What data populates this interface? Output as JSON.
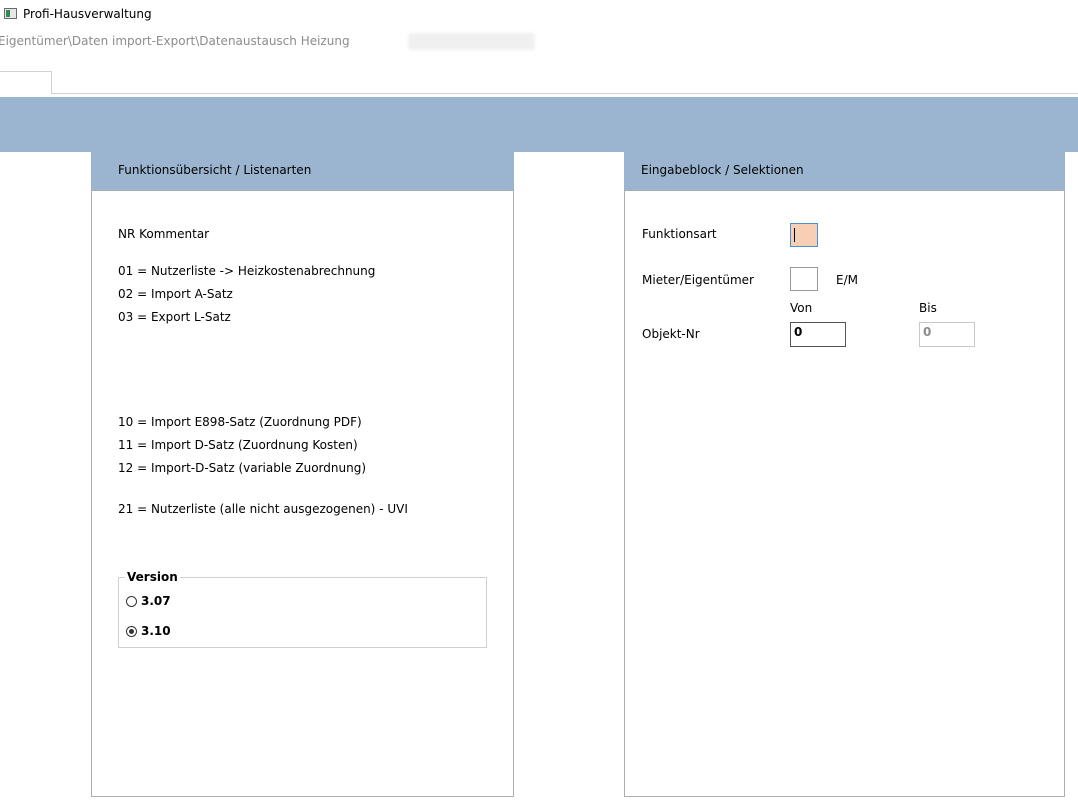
{
  "window": {
    "title": "Profi-Hausverwaltung",
    "breadcrumb": "Eigentümer\\Daten import-Export\\Datenaustausch Heizung"
  },
  "left_panel": {
    "header": "Funktionsübersicht / Listenarten",
    "column_header": "NR   Kommentar",
    "lines": [
      "01 = Nutzerliste -> Heizkostenabrechnung",
      "02 = Import A-Satz",
      "03 = Export L-Satz",
      "10 = Import E898-Satz (Zuordnung PDF)",
      "11 = Import D-Satz (Zuordnung Kosten)",
      "12 = Import-D-Satz (variable Zuordnung)",
      "21 = Nutzerliste (alle nicht ausgezogenen) - UVI"
    ],
    "version": {
      "legend": "Version",
      "options": [
        {
          "label": "3.07",
          "selected": false
        },
        {
          "label": "3.10",
          "selected": true
        }
      ]
    }
  },
  "right_panel": {
    "header": "Eingabeblock / Selektionen",
    "funktionsart_label": "Funktionsart",
    "funktionsart_value": "",
    "mieter_label": "Mieter/Eigentümer",
    "mieter_value": "",
    "mieter_hint": "E/M",
    "von_label": "Von",
    "bis_label": "Bis",
    "objekt_label": "Objekt-Nr",
    "objekt_von": "0",
    "objekt_bis": "0"
  },
  "colors": {
    "header_blue": "#9bb5d1",
    "active_field": "#f7cfb4"
  }
}
